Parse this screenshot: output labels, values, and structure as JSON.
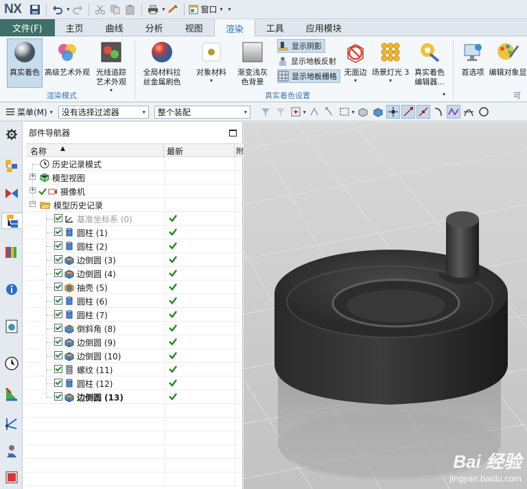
{
  "app": {
    "logo": "NX",
    "window_menu": "窗口"
  },
  "tabs": [
    "文件(F)",
    "主页",
    "曲线",
    "分析",
    "视图",
    "渲染",
    "工具",
    "应用模块"
  ],
  "active_tab": "渲染",
  "ribbon": {
    "render_mode_group": "渲染模式",
    "true_shading_settings_group": "真实着色设置",
    "truncated_group": "可视",
    "buttons": {
      "true_shading": "真实着色",
      "advanced_studio": "高级艺术外观",
      "ray_traced_studio_1": "光线追踪",
      "ray_traced_studio_2": "艺术外观",
      "global_material_1": "全局材料拉",
      "global_material_2": "丝金属刷色",
      "object_material": "对象材料",
      "gradient_bg_1": "渐变浅灰",
      "gradient_bg_2": "色背景",
      "show_shadows": "显示阴影",
      "show_floor_reflection": "显示地板反射",
      "show_floor_grid": "显示地板栅格",
      "no_faces": "无面边",
      "scene_lights": "场景灯光 3",
      "true_shading_editor_1": "真实着色",
      "true_shading_editor_2": "编辑器...",
      "preferences": "首选项",
      "edit_object_display": "编辑对象显"
    }
  },
  "selection_bar": {
    "menu_label": "菜单(M)",
    "filter_value": "没有选择过滤器",
    "scope_value": "整个装配"
  },
  "navigator": {
    "title": "部件导航器",
    "col_name": "名称",
    "col_latest": "最新",
    "col_cut": "附",
    "top_nodes": {
      "history_mode": "历史记录模式",
      "model_views": "模型视图",
      "cameras": "摄像机",
      "model_history": "模型历史记录"
    },
    "features": [
      {
        "label": "基准坐标系 (0)",
        "icon": "datum-csys-icon"
      },
      {
        "label": "圆柱 (1)",
        "icon": "cylinder-icon"
      },
      {
        "label": "圆柱 (2)",
        "icon": "cylinder-icon"
      },
      {
        "label": "边倒圆 (3)",
        "icon": "edge-blend-icon"
      },
      {
        "label": "边倒圆 (4)",
        "icon": "edge-blend-icon"
      },
      {
        "label": "抽壳 (5)",
        "icon": "shell-icon"
      },
      {
        "label": "圆柱 (6)",
        "icon": "cylinder-icon"
      },
      {
        "label": "圆柱 (7)",
        "icon": "cylinder-icon"
      },
      {
        "label": "倒斜角 (8)",
        "icon": "chamfer-icon"
      },
      {
        "label": "边倒圆 (9)",
        "icon": "edge-blend-icon"
      },
      {
        "label": "边倒圆 (10)",
        "icon": "edge-blend-icon"
      },
      {
        "label": "螺纹 (11)",
        "icon": "thread-icon"
      },
      {
        "label": "圆柱 (12)",
        "icon": "cylinder-icon"
      },
      {
        "label": "边倒圆 (13)",
        "icon": "edge-blend-icon"
      }
    ]
  },
  "watermark": {
    "main": "Bai 经验",
    "sub": "jingyan.baidu.com"
  },
  "colors": {
    "accent": "#1d6ec5",
    "file_tab": "#3f6f68",
    "check_green": "#1c8a1c",
    "group_label": "#3b79b7"
  }
}
